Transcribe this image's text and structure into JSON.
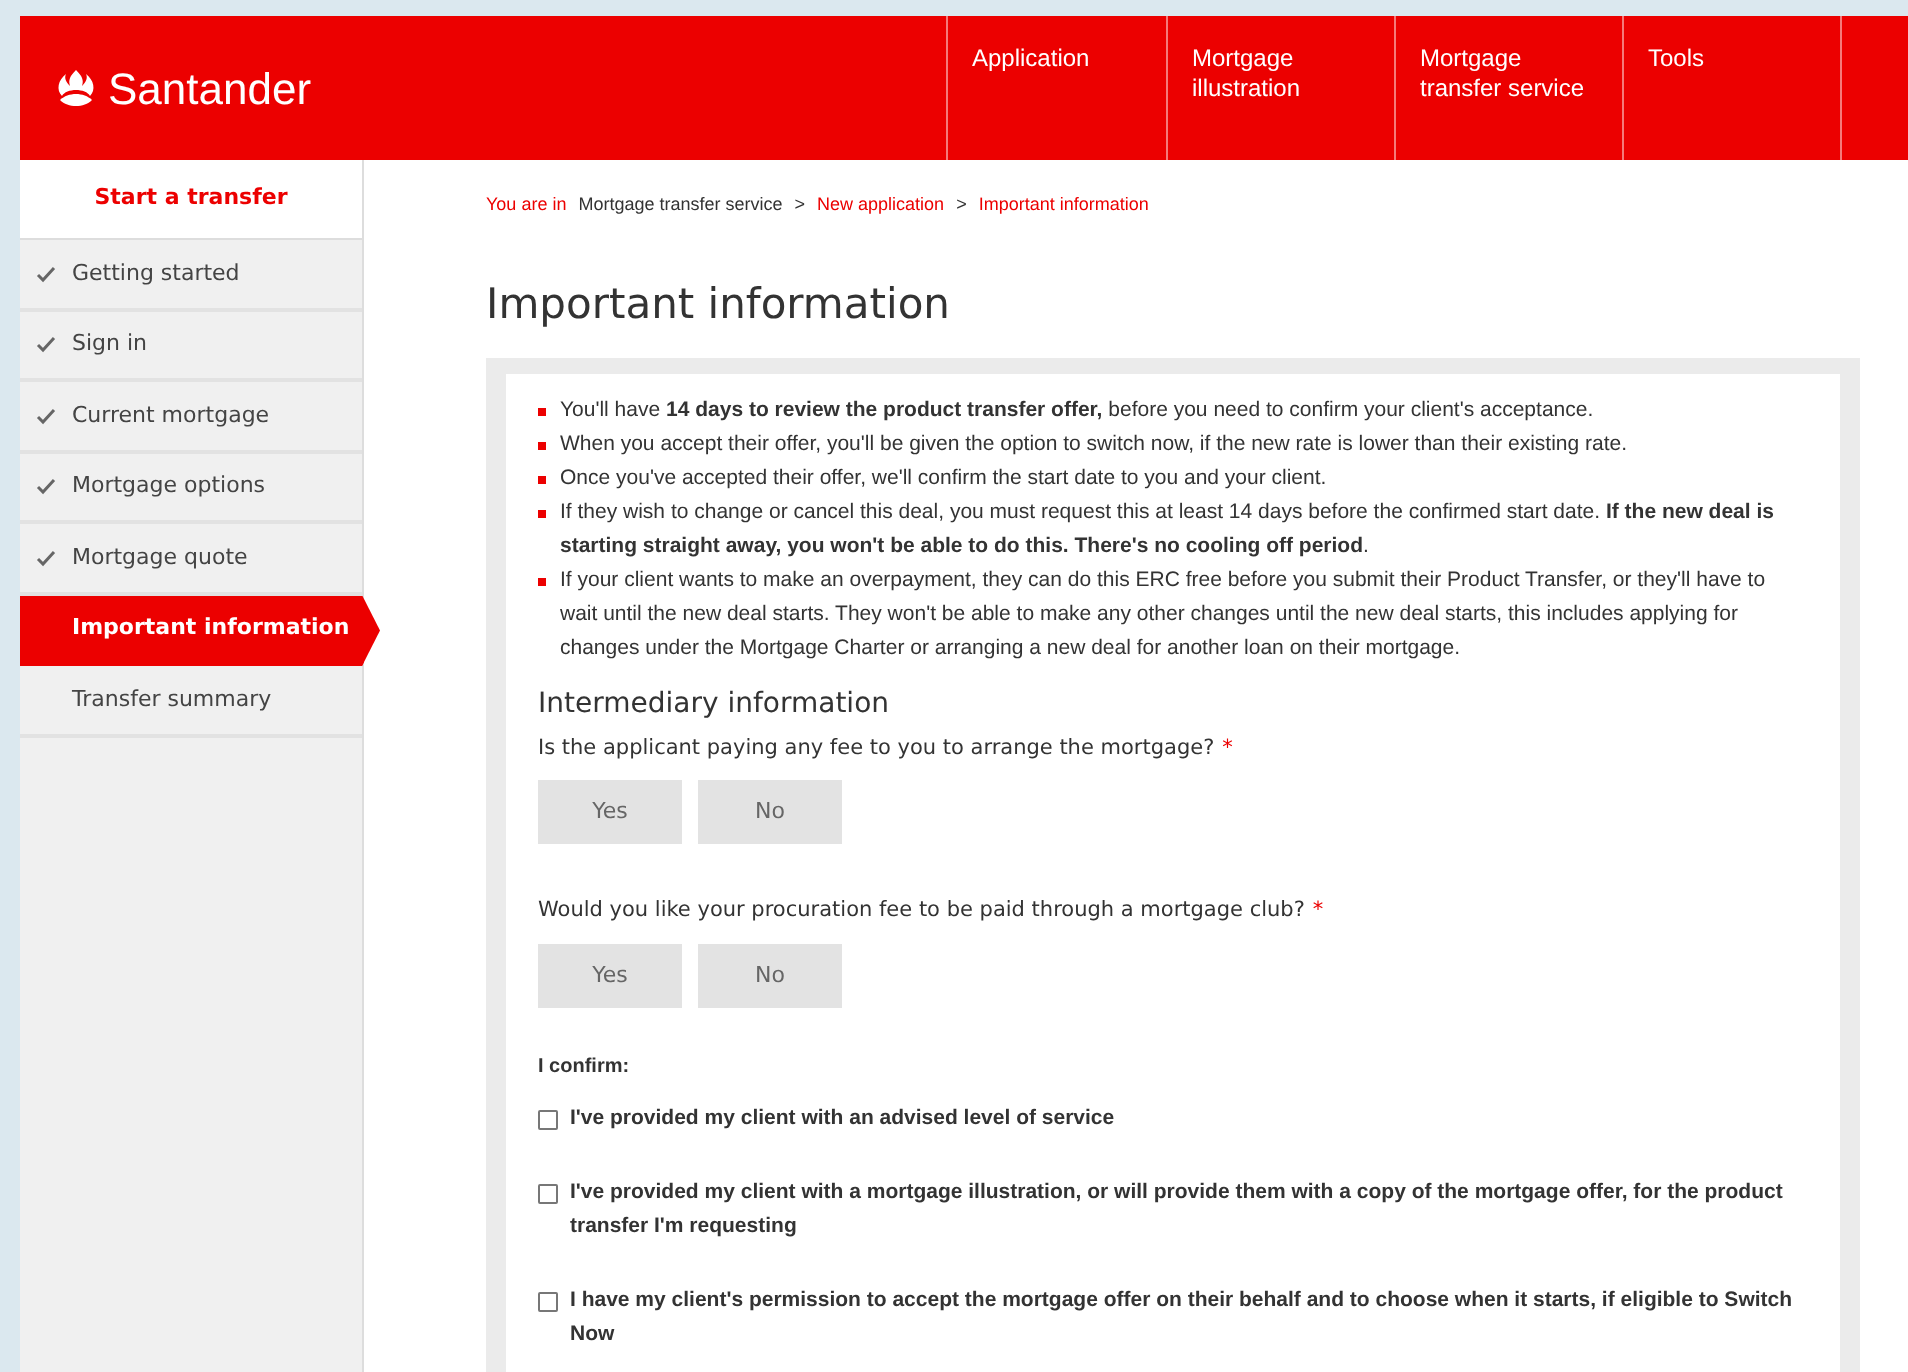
{
  "header": {
    "logo": "Santander",
    "nav": [
      {
        "label": "Application"
      },
      {
        "label": "Mortgage illustration"
      },
      {
        "label": "Mortgage transfer service"
      },
      {
        "label": "Tools"
      }
    ]
  },
  "sidebar": {
    "title": "Start a transfer",
    "steps": [
      {
        "label": "Getting started",
        "done": true,
        "selected": false
      },
      {
        "label": "Sign in",
        "done": true,
        "selected": false
      },
      {
        "label": "Current mortgage",
        "done": true,
        "selected": false
      },
      {
        "label": "Mortgage options",
        "done": true,
        "selected": false
      },
      {
        "label": "Mortgage quote",
        "done": true,
        "selected": false
      },
      {
        "label": "Important information",
        "done": false,
        "selected": true
      },
      {
        "label": "Transfer summary",
        "done": false,
        "selected": false
      }
    ]
  },
  "breadcrumb": {
    "prefix": "You are in",
    "items": [
      {
        "label": "Mortgage transfer service",
        "kind": "current"
      },
      {
        "label": ">",
        "kind": "sep"
      },
      {
        "label": "New application",
        "kind": "link"
      },
      {
        "label": ">",
        "kind": "sep"
      },
      {
        "label": "Important information",
        "kind": "link"
      }
    ]
  },
  "title": "Important information",
  "bullets": [
    "You'll have **14 days to review the product transfer offer,** before you need to confirm your client's acceptance.",
    "When you accept their offer, you'll be given the option to switch now, if the new rate is lower than their existing rate.",
    "Once you've accepted their offer, we'll confirm the start date to you and your client.",
    "If they wish to change or cancel this deal, you must request this at least 14 days before the confirmed start date. **If the new deal is starting straight away, you won't be able to do this. There's no cooling off period**.",
    "If your client wants to make an overpayment, they can do this ERC free before you submit their Product Transfer, or they'll have to wait until the new deal starts. They won't be able to make any other changes until the new deal starts, this includes applying for changes under the Mortgage Charter or arranging a new deal for another loan on their mortgage."
  ],
  "section_title": "Intermediary information",
  "questions": [
    {
      "label": "Is the applicant paying any fee to you to arrange the mortgage?",
      "required_mark": "*",
      "options": [
        {
          "label": "Yes",
          "selected": false
        },
        {
          "label": "No",
          "selected": false
        }
      ]
    },
    {
      "label": "Would you like your procuration fee to be paid through a mortgage club?",
      "required_mark": "*",
      "options": [
        {
          "label": "Yes",
          "selected": false
        },
        {
          "label": "No",
          "selected": false
        }
      ]
    }
  ],
  "confirm": {
    "label": "I confirm:",
    "items": [
      {
        "label": "I've provided my client with an advised level of service",
        "checked": false
      },
      {
        "label": "I've provided my client with a mortgage illustration, or will provide them with a copy of the mortgage offer, for the product transfer I'm requesting",
        "checked": false
      },
      {
        "label": "I have my client's permission to accept the mortgage offer on their behalf and to choose when it starts, if eligible to Switch Now",
        "checked": false
      }
    ]
  }
}
